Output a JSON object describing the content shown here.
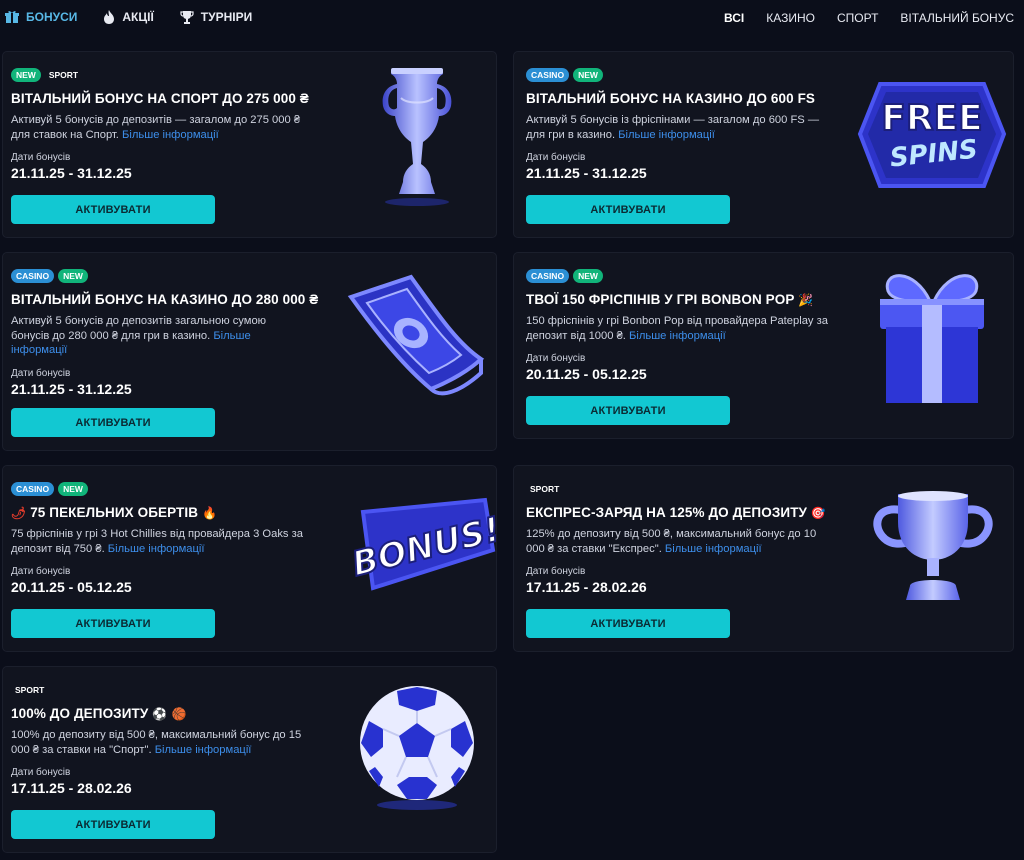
{
  "nav": {
    "bonus_label": "БОНУСИ",
    "actions_label": "АКЦІЇ",
    "tournaments_label": "ТУРНІРИ",
    "filters": [
      "ВСІ",
      "КАЗИНО",
      "СПОРТ",
      "ВІТАЛЬНИЙ БОНУС"
    ]
  },
  "common": {
    "dates_label": "Дати бонусів",
    "activate_label": "АКТИВУВАТИ",
    "more_label": "Більше інформації"
  },
  "cards": [
    {
      "badges": [
        "NEW",
        "SPORT"
      ],
      "title": "ВІТАЛЬНИЙ БОНУС НА СПОРТ ДО 275 000 ₴",
      "desc": "Активуй 5 бонусів до депозитів — загалом до 275 000 ₴ для ставок на Спорт.",
      "dates": "21.11.25 - 31.12.25",
      "art": "trophy-cup-icon"
    },
    {
      "badges": [
        "CASINO",
        "NEW"
      ],
      "title": "ВІТАЛЬНИЙ БОНУС НА КАЗИНО ДО 600 FS",
      "desc": "Активуй 5 бонусів із фріспінами — загалом до 600 FS — для гри в казино.",
      "dates": "21.11.25 - 31.12.25",
      "art": "free-spins-icon",
      "art_text_1": "FREE",
      "art_text_2": "SPINS"
    },
    {
      "badges": [
        "CASINO",
        "NEW"
      ],
      "title": "ВІТАЛЬНИЙ БОНУС НА КАЗИНО ДО 280 000 ₴",
      "desc": "Активуй 5 бонусів до депозитів загальною сумою бонусів до 280 000 ₴ для гри в казино.",
      "dates": "21.11.25 - 31.12.25",
      "art": "banknote-icon"
    },
    {
      "badges": [
        "CASINO",
        "NEW"
      ],
      "title": "ТВОЇ 150 ФРІСПІНІВ У ГРІ BONBON POP",
      "title_emoji": "🎉",
      "desc": "150 фріспінів у грі Bonbon Pop від провайдера Pateplay за депозит від 1000 ₴.",
      "dates": "20.11.25 - 05.12.25",
      "art": "gift-box-icon"
    },
    {
      "badges": [
        "CASINO",
        "NEW"
      ],
      "title_emoji_before": "🌶",
      "title": "75 ПЕКЕЛЬНИХ ОБЕРТІВ",
      "title_emoji": "🔥",
      "desc": "75 фріспінів у грі 3 Hot Chillies від провайдера 3 Oaks за депозит від 750 ₴.",
      "dates": "20.11.25 - 05.12.25",
      "art": "bonus-sign-icon",
      "art_text_1": "BONUS!"
    },
    {
      "badges": [
        "SPORT"
      ],
      "title": "ЕКСПРЕС-ЗАРЯД НА 125% ДО ДЕПОЗИТУ",
      "title_emoji": "🎯",
      "desc": "125% до депозиту від 500 ₴, максимальний бонус до 10 000 ₴ за ставки \"Експрес\".",
      "dates": "17.11.25 - 28.02.26",
      "art": "winner-cup-icon"
    },
    {
      "badges": [
        "SPORT"
      ],
      "title": "100% ДО ДЕПОЗИТУ",
      "title_emoji": "⚽ 🏀",
      "desc": "100% до депозиту від 500 ₴, максимальний бонус до 15 000 ₴ за ставки на \"Спорт\".",
      "dates": "17.11.25 - 28.02.26",
      "art": "soccer-ball-icon"
    }
  ]
}
